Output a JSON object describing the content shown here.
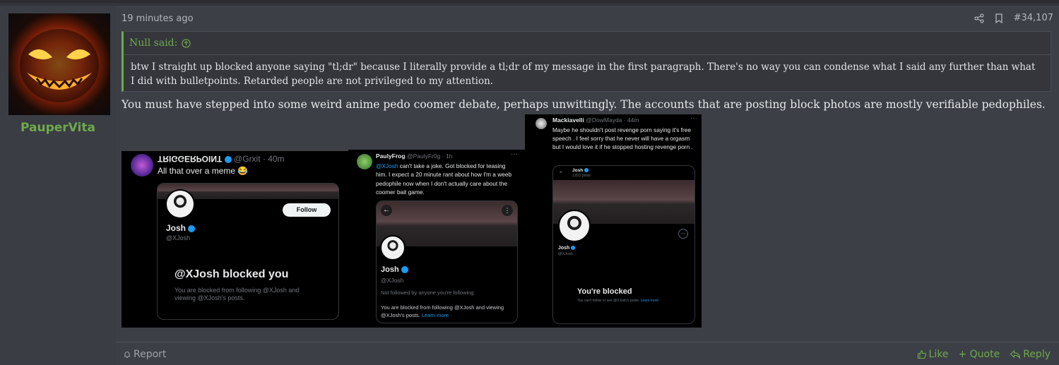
{
  "post": {
    "username": "PauperVita",
    "time": "19 minutes ago",
    "post_number": "#34,107",
    "message": "You must have stepped into some weird anime pedo coomer debate, perhaps unwittingly. The accounts that are posting block photos are mostly verifiable pedophiles."
  },
  "quote": {
    "author": "Null said:",
    "text": "btw I straight up blocked anyone saying \"tl;dr\" because I literally provide a tl;dr of my message in the first paragraph. There's no way you can condense what I said any further than what I did with bulletpoints. Retarded people are not privileged to my attention."
  },
  "actions": {
    "report": "Report",
    "like": "Like",
    "quote": "+ Quote",
    "reply": "Reply"
  },
  "shot1": {
    "name": "TRIGGERPOINT",
    "handle": "@Grxit · 40m",
    "text": "All that over a meme 😂",
    "follow": "Follow",
    "profile_name": "Josh",
    "profile_handle": "@XJosh",
    "blocked_title": "@XJosh blocked you",
    "blocked_text": "You are blocked from following @XJosh and viewing @XJosh's posts."
  },
  "shot2": {
    "name": "PaulyFrog",
    "handle": "@PaulyFr0g · 1h",
    "mention": "@XJosh",
    "text": " can't take a joke. Got blocked for teasing him. I expect a 20 minute rant about how I'm a weeb pedophile now when I don't actually care about the coomer bait game.",
    "profile_name": "Josh",
    "profile_handle": "@XJosh",
    "not_followed": "Not followed by anyone you're following",
    "blocked_text": "You are blocked from following @XJosh and viewing @XJosh's posts. ",
    "learn_more": "Learn more"
  },
  "shot3": {
    "name": "Mackiavelli",
    "handle": "@DowMayda · 44m",
    "text": "Maybe he shouldn't post revenge porn saying it's free speech . I feel sorry that he never will have a orgasm but I would love it if he stopped hosting revenge porn .",
    "mini_name": "Josh",
    "mini_posts": "1,812 posts",
    "profile_name": "Josh",
    "profile_handle": "@XJosh",
    "blocked_title": "You're blocked",
    "blocked_text": "You can't follow or see @XJosh's posts. ",
    "learn_more": "Learn more"
  },
  "colors": {
    "accent": "#6fa94c",
    "twitter_blue": "#1d9bf0",
    "background": "#3c3f46"
  }
}
